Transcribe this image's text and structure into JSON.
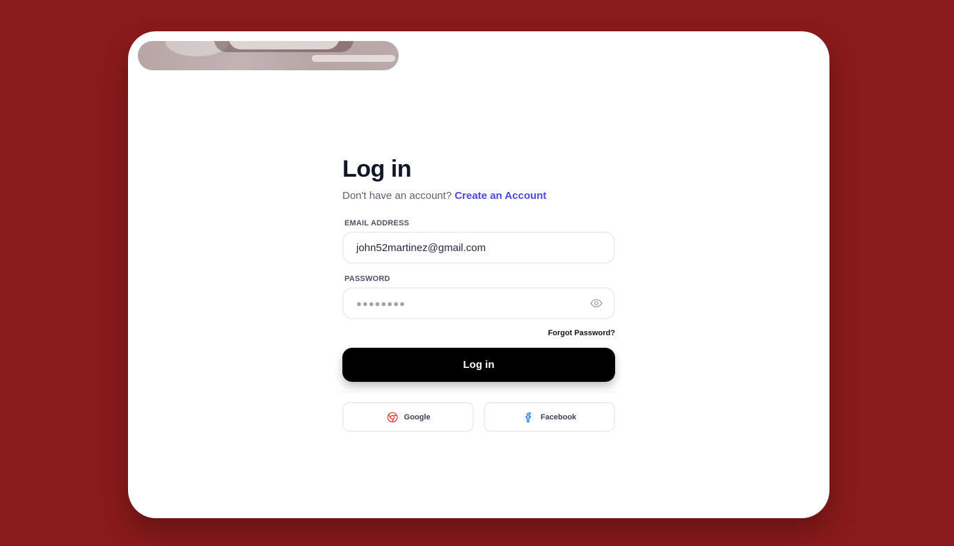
{
  "login": {
    "title": "Log in",
    "subtitle_text": "Don't have an account?",
    "create_account_link": "Create an Account",
    "email_label": "EMAIL ADDRESS",
    "email_value": "john52martinez@gmail.com",
    "password_label": "PASSWORD",
    "password_masked": "●●●●●●●●",
    "forgot_password": "Forgot Password?",
    "login_button": "Log in",
    "social": {
      "google": "Google",
      "facebook": "Facebook"
    }
  },
  "colors": {
    "background": "#8a1a1b",
    "accent": "#4f46e5",
    "button": "#000000",
    "google_icon": "#ea4335",
    "facebook_icon": "#1877f2"
  },
  "icons": [
    "eye-icon",
    "google-icon",
    "facebook-icon"
  ]
}
